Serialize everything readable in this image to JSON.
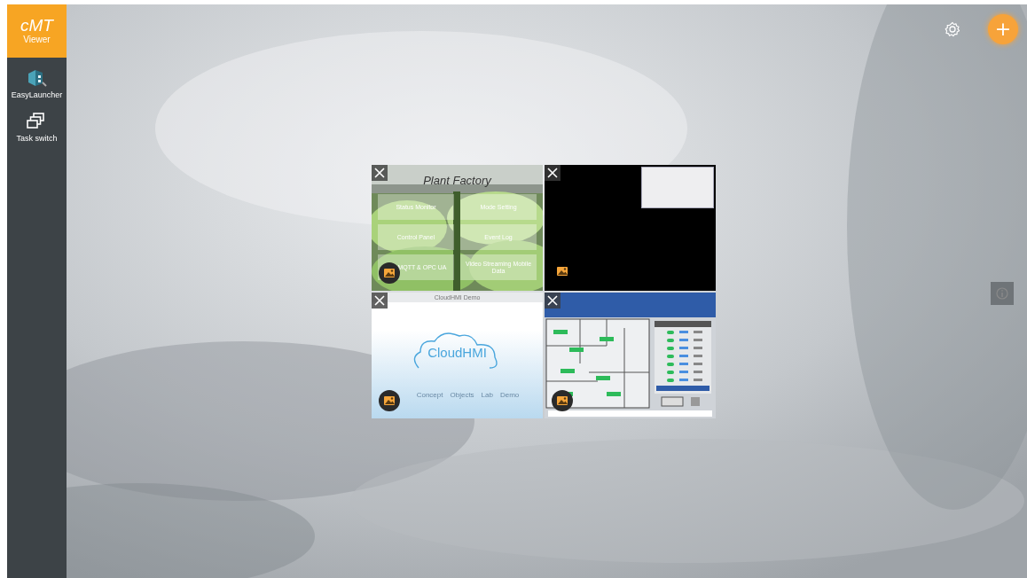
{
  "sidebar": {
    "logo": {
      "brand": "cMT",
      "product": "Viewer"
    },
    "items": [
      {
        "label": "EasyLauncher"
      },
      {
        "label": "Task switch"
      }
    ]
  },
  "toolbar": {
    "add": "+"
  },
  "projects": [
    {
      "kind": "plant",
      "title": "Plant Factory",
      "buttons": [
        {
          "label": "Status Monitor"
        },
        {
          "label": "Mode Setting"
        },
        {
          "label": "Control Panel"
        },
        {
          "label": "Event Log"
        },
        {
          "label": "MQTT & OPC UA"
        },
        {
          "label": "Video Streaming Mobile Data"
        }
      ]
    },
    {
      "kind": "blank"
    },
    {
      "kind": "cloud",
      "title": "CloudHMI Demo",
      "logo": "CloudHMI",
      "tabs": [
        {
          "label": "Concept"
        },
        {
          "label": "Objects"
        },
        {
          "label": "Lab"
        },
        {
          "label": "Demo"
        }
      ]
    },
    {
      "kind": "floorplan"
    }
  ]
}
